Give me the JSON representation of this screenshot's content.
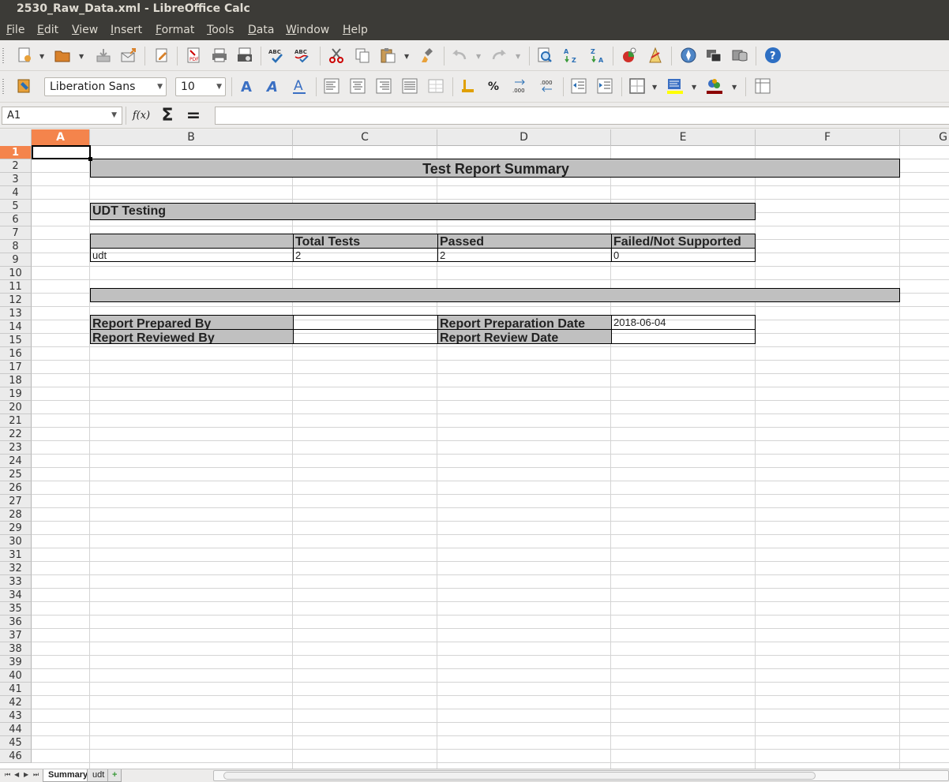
{
  "window": {
    "title": "2530_Raw_Data.xml - LibreOffice Calc"
  },
  "menu": [
    "File",
    "Edit",
    "View",
    "Insert",
    "Format",
    "Tools",
    "Data",
    "Window",
    "Help"
  ],
  "format_bar": {
    "font_name": "Liberation Sans",
    "font_size": "10"
  },
  "formula_bar": {
    "name_box": "A1",
    "function_wizard": "f(x)",
    "sum": "Σ",
    "equals": "=",
    "formula": ""
  },
  "columns": [
    "A",
    "B",
    "C",
    "D",
    "E",
    "F",
    "G"
  ],
  "selected_column": "A",
  "rows": [
    "1",
    "2",
    "3",
    "4",
    "5",
    "6",
    "7",
    "8",
    "9",
    "10",
    "11",
    "12",
    "13",
    "14",
    "15",
    "16",
    "17",
    "18",
    "19",
    "20",
    "21",
    "22",
    "23",
    "24",
    "25",
    "26",
    "27",
    "28",
    "29",
    "30",
    "31",
    "32",
    "33",
    "34",
    "35",
    "36",
    "37",
    "38",
    "39",
    "40",
    "41",
    "42",
    "43",
    "44",
    "45",
    "46"
  ],
  "selected_row": "1",
  "sheet": {
    "title": "Test Report Summary",
    "section_title": "UDT Testing",
    "table": {
      "headers": [
        "",
        "Total Tests",
        "Passed",
        "Failed/Not Supported"
      ],
      "rows": [
        [
          "udt",
          "2",
          "2",
          "0"
        ]
      ]
    },
    "signoff": {
      "prepared_by_label": "Report Prepared By",
      "prepared_by_value": "",
      "prep_date_label": "Report Preparation Date",
      "prep_date_value": "2018-06-04",
      "reviewed_by_label": "Report Reviewed By",
      "reviewed_by_value": "",
      "review_date_label": "Report Review Date",
      "review_date_value": ""
    }
  },
  "tabs": [
    "Summary",
    "udt"
  ],
  "active_tab": "Summary"
}
